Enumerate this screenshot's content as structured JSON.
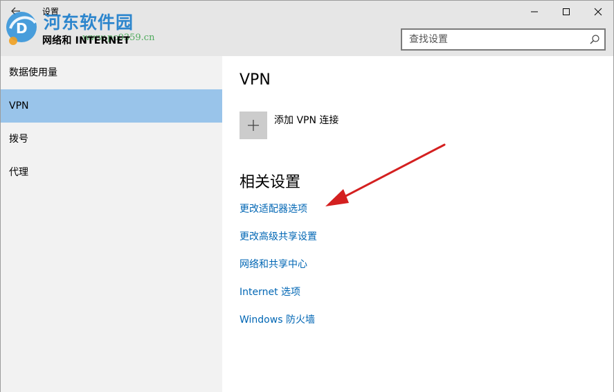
{
  "window": {
    "app_title": "设置",
    "section_title": "网络和 INTERNET"
  },
  "watermark": {
    "brand": "河东软件园",
    "url": "www.pc0359.cn"
  },
  "search": {
    "placeholder": "查找设置"
  },
  "sidebar": {
    "items": [
      {
        "label": "数据使用量"
      },
      {
        "label": "VPN"
      },
      {
        "label": "拨号"
      },
      {
        "label": "代理"
      }
    ],
    "selected": "VPN"
  },
  "main": {
    "heading": "VPN",
    "add_label": "添加 VPN 连接",
    "related_heading": "相关设置",
    "links": [
      {
        "label": "更改适配器选项"
      },
      {
        "label": "更改高级共享设置"
      },
      {
        "label": "网络和共享中心"
      },
      {
        "label": "Internet 选项"
      },
      {
        "label": "Windows 防火墙"
      }
    ]
  },
  "colors": {
    "accent": "#0066b4",
    "selected_bg": "#99c4ea",
    "header_bg": "#e6e6e6",
    "sidebar_bg": "#f2f2f2",
    "annotation_arrow": "#d42020"
  },
  "icons": {
    "back": "back-arrow-icon",
    "minimize": "minimize-icon",
    "maximize": "maximize-icon",
    "close": "close-icon",
    "search": "search-icon",
    "add": "plus-icon"
  }
}
